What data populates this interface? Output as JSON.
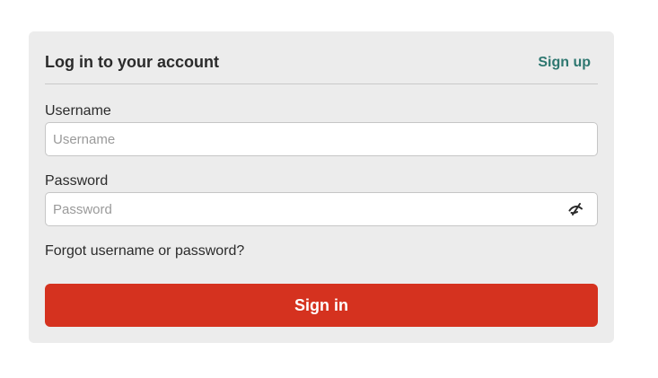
{
  "login_card": {
    "title": "Log in to your account",
    "signup_label": "Sign up",
    "username": {
      "label": "Username",
      "placeholder": "Username",
      "value": ""
    },
    "password": {
      "label": "Password",
      "placeholder": "Password",
      "value": "",
      "toggle_icon": "eye-slash-icon"
    },
    "forgot_label": "Forgot username or password?",
    "signin_label": "Sign in"
  },
  "colors": {
    "card_background": "#ececec",
    "accent_link": "#2e7770",
    "primary_button": "#d5321f",
    "button_text": "#ffffff"
  }
}
